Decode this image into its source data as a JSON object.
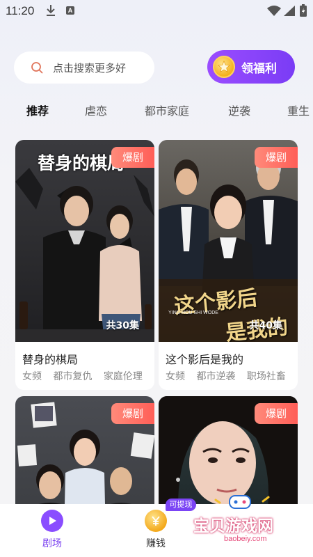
{
  "status_bar": {
    "time": "11:20",
    "icons": [
      "download-icon",
      "a-notification-icon",
      "wifi-icon",
      "signal-icon",
      "battery-icon"
    ]
  },
  "search": {
    "placeholder": "点击搜索更多好"
  },
  "welfare_button": {
    "label": "领福利",
    "icon": "coin-star-icon"
  },
  "tabs": [
    {
      "label": "推荐",
      "active": true
    },
    {
      "label": "虐恋",
      "active": false
    },
    {
      "label": "都市家庭",
      "active": false
    },
    {
      "label": "逆袭",
      "active": false
    },
    {
      "label": "重生",
      "active": false
    }
  ],
  "cards": [
    {
      "badge": "爆剧",
      "poster_title": "替身的棋局",
      "episodes": "共30集",
      "title": "替身的棋局",
      "tags": [
        "女频",
        "都市复仇",
        "家庭伦理"
      ]
    },
    {
      "badge": "爆剧",
      "poster_title_line1": "这个影后",
      "poster_title_line2": "是我的",
      "poster_subtitle": "YING HOU SHI WODE",
      "episodes": "共40集",
      "title": "这个影后是我的",
      "tags": [
        "女频",
        "都市逆袭",
        "职场社畜"
      ]
    },
    {
      "badge": "爆剧"
    },
    {
      "badge": "爆剧"
    }
  ],
  "bottom_nav": {
    "items": [
      {
        "label": "剧场",
        "icon": "play-icon",
        "active": true
      },
      {
        "label": "赚钱",
        "icon": "yuan-coin-icon",
        "active": false
      }
    ],
    "withdraw_badge": "可提现"
  },
  "watermark": {
    "text": "宝贝游戏网",
    "url": "baobeiy.com"
  },
  "colors": {
    "accent": "#7a3cf5",
    "badge": "#ff5e57",
    "coin": "#f4b11e"
  }
}
